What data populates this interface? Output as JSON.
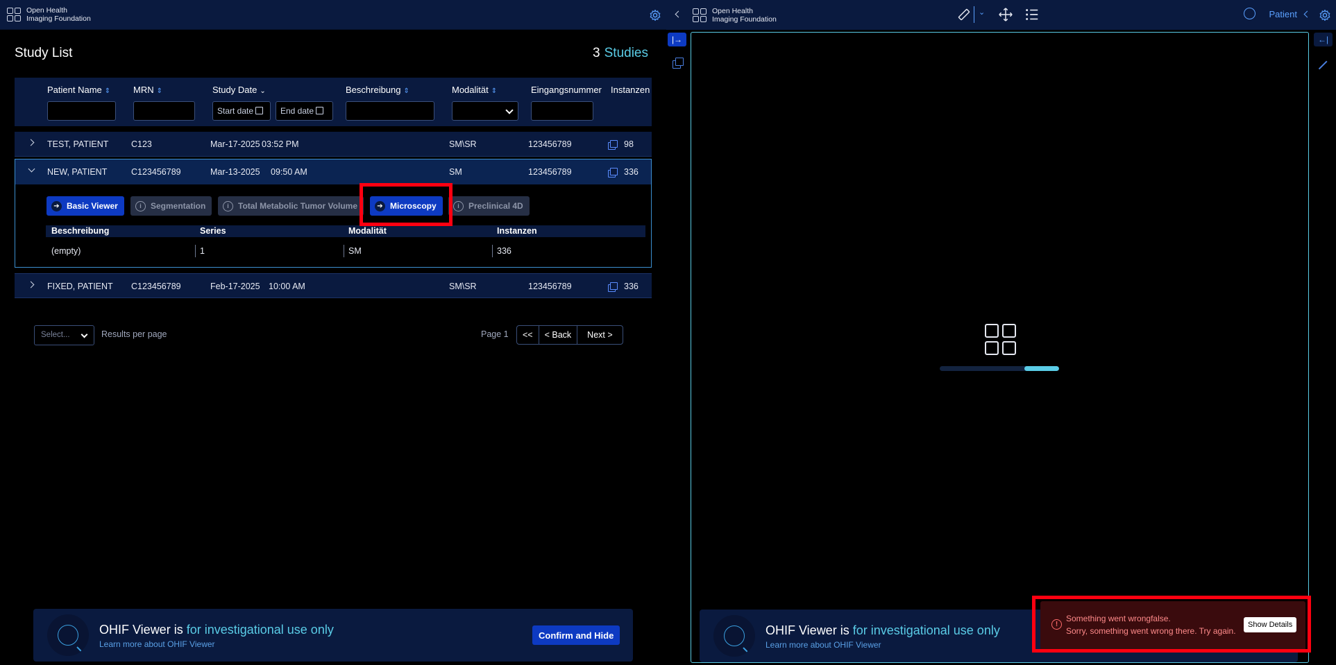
{
  "brand": {
    "line1": "Open Health",
    "line2": "Imaging Foundation"
  },
  "study_list": {
    "title": "Study List",
    "count": "3",
    "count_label": "Studies",
    "columns": {
      "patient_name": "Patient Name",
      "mrn": "MRN",
      "study_date": "Study Date",
      "description": "Beschreibung",
      "modality": "Modalität",
      "accession": "Eingangsnummer",
      "instances": "Instanzen"
    },
    "start_date_placeholder": "Start date",
    "end_date_placeholder": "End date",
    "rows": [
      {
        "name": "TEST, PATIENT",
        "mrn": "C123",
        "date": "Mar-17-2025",
        "time": "03:52 PM",
        "modality": "SM\\SR",
        "accession": "123456789",
        "instances": "98"
      },
      {
        "name": "NEW, PATIENT",
        "mrn": "C123456789",
        "date": "Mar-13-2025",
        "time": "09:50 AM",
        "modality": "SM",
        "accession": "123456789",
        "instances": "336"
      },
      {
        "name": "FIXED, PATIENT",
        "mrn": "C123456789",
        "date": "Feb-17-2025",
        "time": "10:00 AM",
        "modality": "SM\\SR",
        "accession": "123456789",
        "instances": "336"
      }
    ],
    "modes": [
      {
        "label": "Basic Viewer",
        "enabled": true
      },
      {
        "label": "Segmentation",
        "enabled": false
      },
      {
        "label": "Total Metabolic Tumor Volume",
        "enabled": false
      },
      {
        "label": "Microscopy",
        "enabled": true
      },
      {
        "label": "Preclinical 4D",
        "enabled": false
      }
    ],
    "series_columns": {
      "description": "Beschreibung",
      "series": "Series",
      "modality": "Modalität",
      "instances": "Instanzen"
    },
    "series_rows": [
      {
        "description": "(empty)",
        "series": "1",
        "modality": "SM",
        "instances": "336"
      }
    ],
    "pagination": {
      "select_placeholder": "Select...",
      "results_label": "Results per page",
      "page_label": "Page 1",
      "first": "<<",
      "back": "< Back",
      "next": "Next >"
    }
  },
  "banner": {
    "title_prefix": "OHIF Viewer is ",
    "title_accent": "for investigational use only",
    "link": "Learn more about OHIF Viewer",
    "confirm": "Confirm and Hide"
  },
  "viewer": {
    "patient_label": "Patient",
    "loading_progress": 0.29
  },
  "toast": {
    "title": "Something went wrongfalse.",
    "message": "Sorry, something went wrong there. Try again.",
    "details_button": "Show Details"
  },
  "colors": {
    "header_bg": "#0a1a3f",
    "accent": "#5acce6",
    "primary_button": "#0d3ac2",
    "highlight": "#ff0010",
    "error_bg": "#3a0b0d"
  }
}
